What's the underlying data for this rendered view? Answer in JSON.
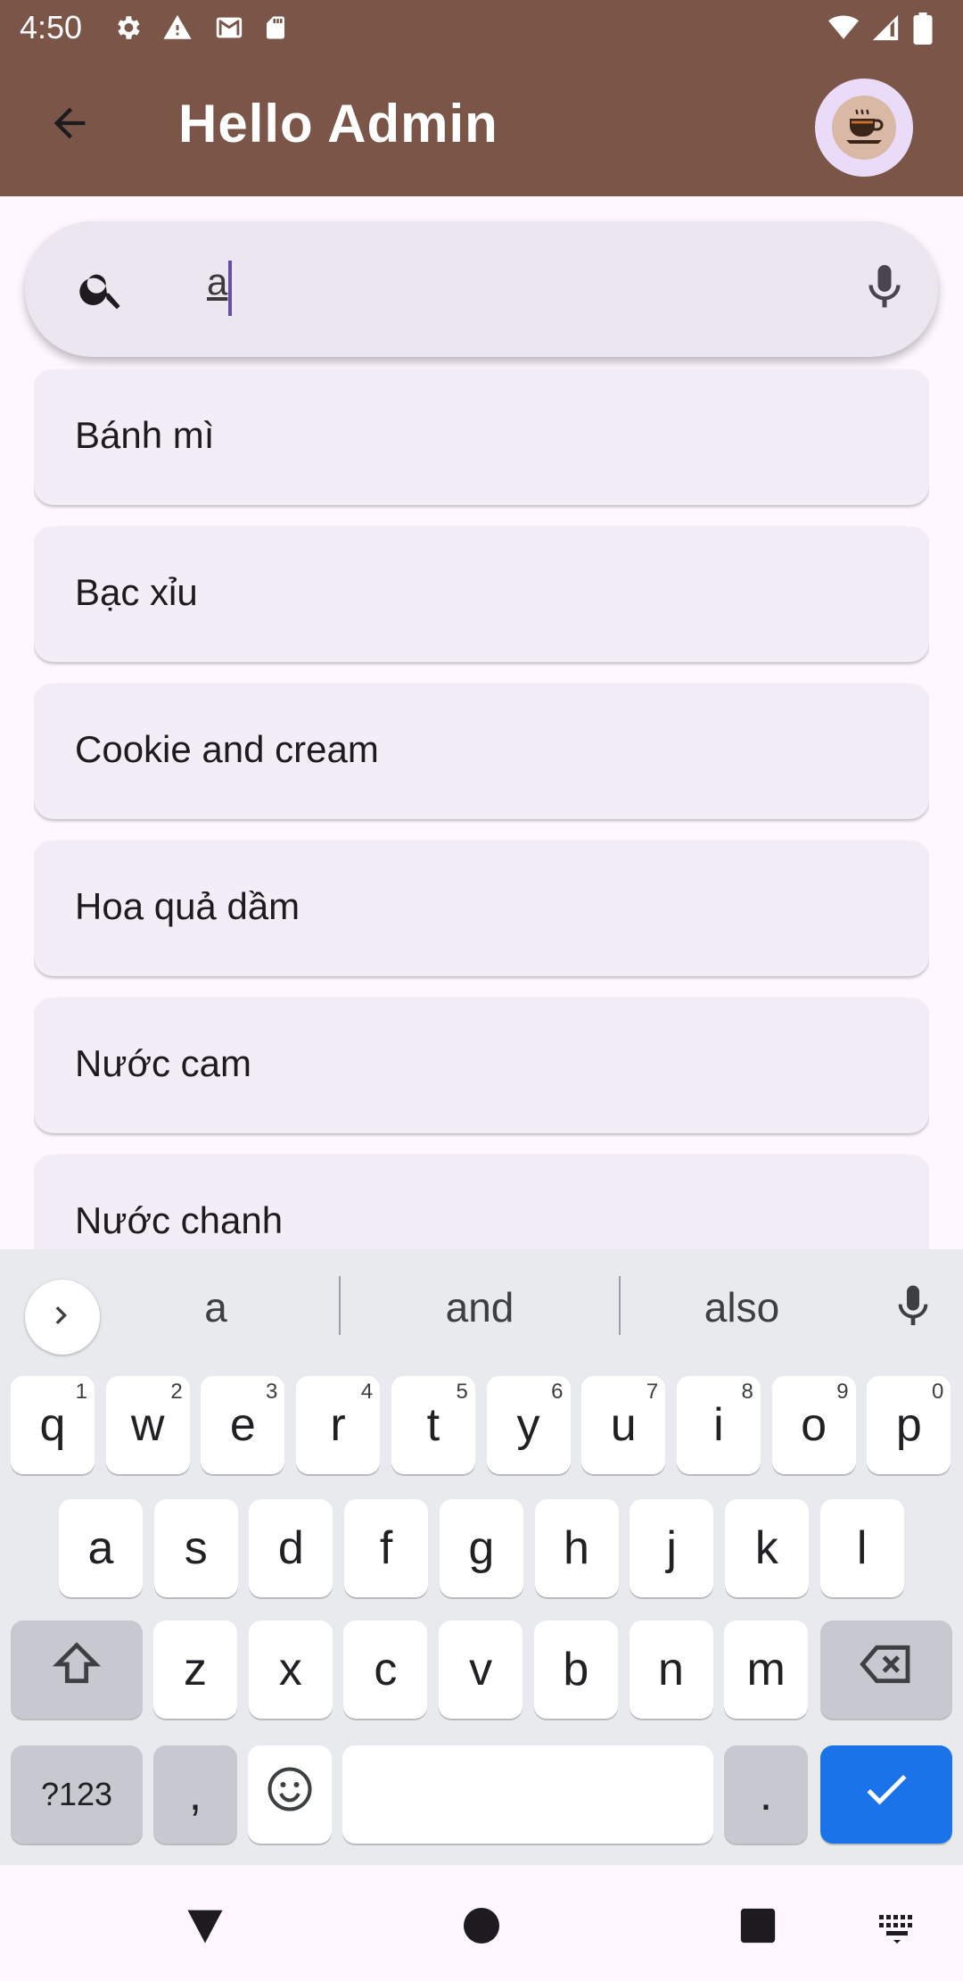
{
  "status": {
    "time": "4:50",
    "left_icons": [
      "settings-icon",
      "warning-icon",
      "gmail-icon",
      "sd-card-icon"
    ],
    "right_icons": [
      "wifi-icon",
      "signal-icon",
      "battery-icon"
    ]
  },
  "appbar": {
    "title": "Hello Admin",
    "back_icon": "arrow-back-icon",
    "avatar_icon": "coffee-cup-icon"
  },
  "search": {
    "value": "a",
    "icon": "search-icon",
    "mic_icon": "mic-icon"
  },
  "results": [
    {
      "label": "Bánh mì"
    },
    {
      "label": "Bạc xỉu"
    },
    {
      "label": "Cookie and cream"
    },
    {
      "label": "Hoa quả dầm"
    },
    {
      "label": "Nước cam"
    },
    {
      "label": "Nước chanh"
    }
  ],
  "keyboard": {
    "suggestions": [
      "a",
      "and",
      "also"
    ],
    "row1": [
      {
        "k": "q",
        "h": "1"
      },
      {
        "k": "w",
        "h": "2"
      },
      {
        "k": "e",
        "h": "3"
      },
      {
        "k": "r",
        "h": "4"
      },
      {
        "k": "t",
        "h": "5"
      },
      {
        "k": "y",
        "h": "6"
      },
      {
        "k": "u",
        "h": "7"
      },
      {
        "k": "i",
        "h": "8"
      },
      {
        "k": "o",
        "h": "9"
      },
      {
        "k": "p",
        "h": "0"
      }
    ],
    "row2": [
      "a",
      "s",
      "d",
      "f",
      "g",
      "h",
      "j",
      "k",
      "l"
    ],
    "row3": [
      "z",
      "x",
      "c",
      "v",
      "b",
      "n",
      "m"
    ],
    "symbols_label": "?123",
    "comma_label": ",",
    "period_label": ".",
    "accent_color": "#1a73e8"
  },
  "colors": {
    "appbar": "#7a5548",
    "search_bg": "#ece6f0",
    "card_bg": "#f3edf7"
  }
}
